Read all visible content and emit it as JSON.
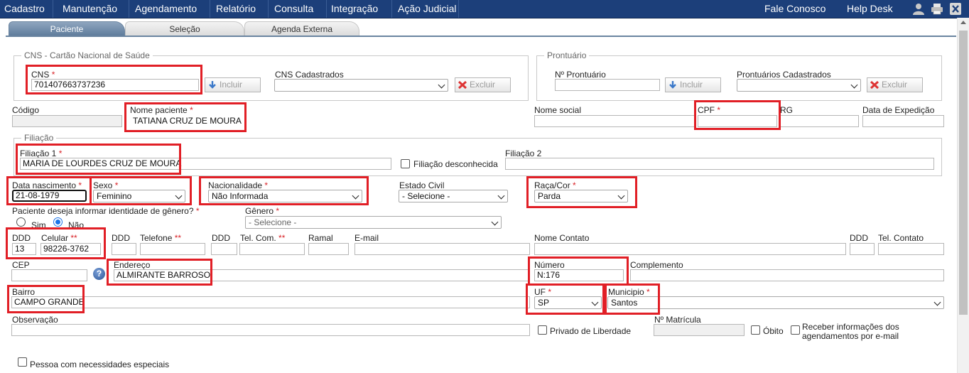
{
  "menu": {
    "items": [
      "Cadastro",
      "Manutenção",
      "Agendamento",
      "Relatório",
      "Consulta",
      "Integração",
      "Ação Judicial"
    ],
    "right_items": [
      "Fale Conosco",
      "Help Desk"
    ],
    "icons": [
      "user-icon",
      "printer-icon",
      "close-icon"
    ]
  },
  "tabs": [
    "Paciente",
    "Seleção",
    "Agenda Externa"
  ],
  "cns": {
    "legend": "CNS - Cartão Nacional de Saúde",
    "cns_label": "CNS",
    "cns_value": "701407663737236",
    "incluir": "Incluir",
    "cadastrados_label": "CNS Cadastrados",
    "cadastrados_value": "",
    "excluir": "Excluir"
  },
  "prontuario": {
    "legend": "Prontuário",
    "numero_label": "Nº Prontuário",
    "numero_value": "",
    "incluir": "Incluir",
    "cadastrados_label": "Prontuários Cadastrados",
    "cadastrados_value": "",
    "excluir": "Excluir"
  },
  "identificacao": {
    "codigo_label": "Código",
    "codigo_value": "",
    "nome_label": "Nome paciente",
    "nome_value": "TATIANA CRUZ DE MOURA",
    "nome_social_label": "Nome social",
    "nome_social_value": "",
    "cpf_label": "CPF",
    "cpf_value": "",
    "rg_label": "RG",
    "rg_value": "",
    "data_expedicao_label": "Data de Expedição",
    "data_expedicao_value": ""
  },
  "filiacao": {
    "legend": "Filiação",
    "filiacao1_label": "Filiação 1",
    "filiacao1_value": "MARIA DE LOURDES CRUZ DE MOURA",
    "desconhecida_label": "Filiação desconhecida",
    "filiacao2_label": "Filiação 2",
    "filiacao2_value": ""
  },
  "dados": {
    "nascimento_label": "Data nascimento",
    "nascimento_value": "21-08-1979",
    "sexo_label": "Sexo",
    "sexo_value": "Feminino",
    "nacionalidade_label": "Nacionalidade",
    "nacionalidade_value": "Não Informada",
    "estado_civil_label": "Estado Civil",
    "estado_civil_value": "- Selecione -",
    "raca_label": "Raça/Cor",
    "raca_value": "Parda"
  },
  "genero": {
    "pergunta_label": "Paciente deseja informar identidade de gênero?",
    "sim_label": "Sim",
    "nao_label": "Não",
    "selected": "Não",
    "genero_label": "Gênero",
    "genero_value": "- Selecione -"
  },
  "contato": {
    "ddd_label": "DDD",
    "ddd_value": "13",
    "celular_label": "Celular",
    "celular_value": "98226-3762",
    "ddd2_label": "DDD",
    "telefone_label": "Telefone",
    "ddd3_label": "DDD",
    "telcom_label": "Tel. Com.",
    "ramal_label": "Ramal",
    "email_label": "E-mail",
    "nome_contato_label": "Nome Contato",
    "ddd4_label": "DDD",
    "tel_contato_label": "Tel. Contato",
    "double_asterisk": "**",
    "asterisk": "*"
  },
  "endereco": {
    "cep_label": "CEP",
    "cep_value": "",
    "help": "?",
    "endereco_label": "Endereço",
    "endereco_value": "ALMIRANTE BARROSO",
    "numero_label": "Número",
    "numero_value": "N:176",
    "complemento_label": "Complemento",
    "complemento_value": "",
    "bairro_label": "Bairro",
    "bairro_value": "CAMPO GRANDE",
    "uf_label": "UF",
    "uf_value": "SP",
    "municipio_label": "Municipio",
    "municipio_value": "Santos"
  },
  "outros": {
    "observacao_label": "Observação",
    "observacao_value": "",
    "privado_label": "Privado de Liberdade",
    "matricula_label": "Nº Matrícula",
    "matricula_value": "",
    "obito_label": "Óbito",
    "receber_line1": "Receber informações dos",
    "receber_line2": "agendamentos por e-mail",
    "necessidades_label": "Pessoa com necessidades especiais"
  }
}
